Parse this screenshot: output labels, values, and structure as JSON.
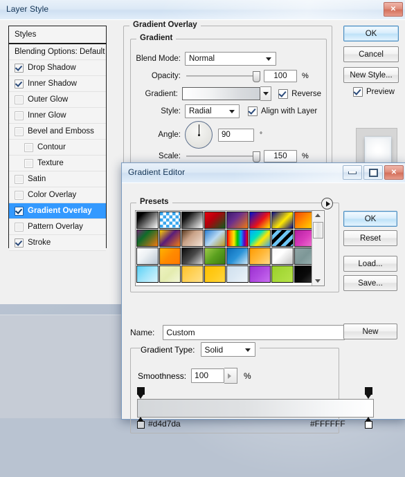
{
  "desktop": {
    "bg_color": "#b9c3d1"
  },
  "layer_style": {
    "title": "Layer Style",
    "window_buttons": {
      "close": "✕"
    },
    "styles_panel": {
      "header": "Styles",
      "items": [
        {
          "label": "Blending Options: Default",
          "checkbox": "none",
          "checked": false,
          "indent": false,
          "selected": false
        },
        {
          "label": "Drop Shadow",
          "checkbox": "checkbox",
          "checked": true,
          "indent": false,
          "selected": false
        },
        {
          "label": "Inner Shadow",
          "checkbox": "checkbox",
          "checked": true,
          "indent": false,
          "selected": false
        },
        {
          "label": "Outer Glow",
          "checkbox": "checkbox",
          "checked": false,
          "indent": false,
          "selected": false
        },
        {
          "label": "Inner Glow",
          "checkbox": "checkbox",
          "checked": false,
          "indent": false,
          "selected": false
        },
        {
          "label": "Bevel and Emboss",
          "checkbox": "checkbox",
          "checked": false,
          "indent": false,
          "selected": false
        },
        {
          "label": "Contour",
          "checkbox": "checkbox",
          "checked": false,
          "indent": true,
          "selected": false
        },
        {
          "label": "Texture",
          "checkbox": "checkbox",
          "checked": false,
          "indent": true,
          "selected": false
        },
        {
          "label": "Satin",
          "checkbox": "checkbox",
          "checked": false,
          "indent": false,
          "selected": false
        },
        {
          "label": "Color Overlay",
          "checkbox": "checkbox",
          "checked": false,
          "indent": false,
          "selected": false
        },
        {
          "label": "Gradient Overlay",
          "checkbox": "checkbox",
          "checked": true,
          "indent": false,
          "selected": true
        },
        {
          "label": "Pattern Overlay",
          "checkbox": "checkbox",
          "checked": false,
          "indent": false,
          "selected": false
        },
        {
          "label": "Stroke",
          "checkbox": "checkbox",
          "checked": true,
          "indent": false,
          "selected": false
        }
      ]
    },
    "gradient_overlay": {
      "section_title": "Gradient Overlay",
      "group_title": "Gradient",
      "blend_mode_label": "Blend Mode:",
      "blend_mode_value": "Normal",
      "opacity_label": "Opacity:",
      "opacity_value": "100",
      "opacity_unit": "%",
      "gradient_label": "Gradient:",
      "reverse_label": "Reverse",
      "reverse_checked": true,
      "style_label": "Style:",
      "style_value": "Radial",
      "align_label": "Align with Layer",
      "align_checked": true,
      "angle_label": "Angle:",
      "angle_value": "90",
      "angle_unit": "°",
      "scale_label": "Scale:",
      "scale_value": "150",
      "scale_unit": "%"
    },
    "buttons": {
      "ok": "OK",
      "cancel": "Cancel",
      "new_style": "New Style...",
      "preview_label": "Preview",
      "preview_checked": true
    }
  },
  "gradient_editor": {
    "title": "Gradient Editor",
    "window_buttons": {
      "minimize": "—",
      "maximize": "❐",
      "close": "✕"
    },
    "presets": {
      "title": "Presets",
      "swatches": [
        "linear-gradient(135deg,#000000 0%,#000000 18%,#ffffff 100%)",
        "repeating-conic-gradient(#ffffff 0 25%, #3aa7ee 0 50%) 0 0/9px 9px",
        "linear-gradient(135deg,#000000 0%,#161616 25%,#ffffff 100%)",
        "linear-gradient(135deg,#e8000f 0%,#b4000c 40%,#0f5c1e 100%)",
        "linear-gradient(135deg,#3a1a6e 0%,#6a2f8e 40%,#f07a12 100%)",
        "linear-gradient(135deg,#0012d0 0%,#e8121b 55%,#ffe800 100%)",
        "linear-gradient(135deg,#0a0a8c 0%,#ffe800 55%,#0a0a8c 100%)",
        "linear-gradient(135deg,#f0440c 0%,#ff8a00 45%,#ffe000 100%)",
        "linear-gradient(135deg,#6d2b6d 0%,#0f6b2a 35%,#f07a12 100%)",
        "linear-gradient(135deg,#ffd000 0%,#5a1d7a 45%,#f07a12 100%)",
        "linear-gradient(135deg,#5a3a20 0%,#c9a288 40%,#f3e3d6 100%)",
        "linear-gradient(135deg,#2a7fd4 0%,#b9d9f2 50%,#b89a22 100%)",
        "linear-gradient(90deg,#ff0000,#ff8a00,#ffe800,#00c000,#00a0ff,#6000c0,#ff0000)",
        "linear-gradient(135deg,#00a6ff 0%,#00e0c0 35%,#ffe800 60%,#3aa7ee 100%)",
        "repeating-linear-gradient(135deg,#000 0 5px,#6ec6f5 5px 10px)",
        "linear-gradient(135deg,#b31fa0 0%,#d83bbb 50%,#f07ad0 100%)",
        "linear-gradient(135deg,#ffffff 0%,#eef2f5 40%,#b9c6d2 100%)",
        "linear-gradient(135deg,#ffb400 0%,#ff8a00 50%,#ff7a00 100%)",
        "linear-gradient(135deg,#0a0a0a 0%,#4a4a4a 50%,#d8d8d8 100%)",
        "linear-gradient(135deg,#9ecb4a 0%,#5aa01e 50%,#3d7a12 100%)",
        "linear-gradient(135deg,#0c6bb8 0%,#2a93d8 50%,#cfe6f5 100%)",
        "linear-gradient(135deg,#ff9a00 0%,#ffb83a 50%,#ffd98a 100%)",
        "linear-gradient(135deg,#f7f7f7 0%,#ffffff 40%,#c4c4c4 100%)",
        "linear-gradient(135deg,#8fa5a5 0%,#7d9797 50%,#9ab0b0 100%)",
        "linear-gradient(135deg,#5ad0f5 0%,#9ee4fa 50%,#d8f3fd 100%)",
        "linear-gradient(135deg,#eef2c0 0%,#e4ecb0 50%,#f2f6d8 100%)",
        "linear-gradient(135deg,#ffc12a 0%,#ffd25a 50%,#ffe08a 100%)",
        "linear-gradient(135deg,#ffc000 0%,#ffca1a 50%,#ffd640 100%)",
        "linear-gradient(135deg,#cfe0ee 0%,#dbe8f3 50%,#eef4fa 100%)",
        "linear-gradient(135deg,#9b2fd0 0%,#b04ae0 50%,#c86ef0 100%)",
        "linear-gradient(135deg,#9ad02a 0%,#a8da3a 50%,#b6e24a 100%)",
        "linear-gradient(135deg,#000000 0%,#0a0a0a 55%,#3a3a3a 100%)"
      ]
    },
    "buttons": {
      "ok": "OK",
      "reset": "Reset",
      "load": "Load...",
      "save": "Save...",
      "new": "New"
    },
    "name_label": "Name:",
    "name_value": "Custom",
    "gradient_type_label": "Gradient Type:",
    "gradient_type_value": "Solid",
    "smoothness_label": "Smoothness:",
    "smoothness_value": "100",
    "smoothness_unit": "%",
    "strip": {
      "left_color": "#d4d7da",
      "right_color": "#FFFFFF",
      "left_hex_label": "#d4d7da",
      "right_hex_label": "#FFFFFF"
    }
  }
}
